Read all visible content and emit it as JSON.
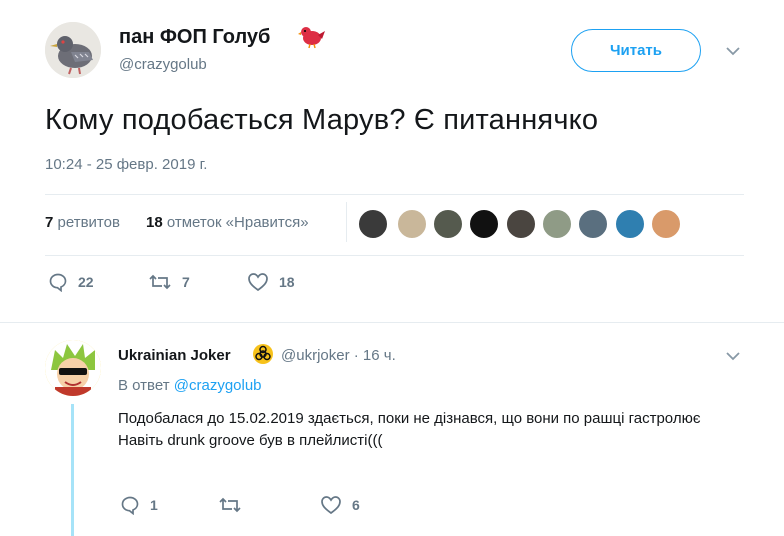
{
  "tweet": {
    "author_name": "пан ФОП Голуб",
    "author_handle": "@crazygolub",
    "follow_label": "Читать",
    "text": "Кому подобається Марув? Є питаннячко",
    "timestamp": "10:24 - 25 февр. 2019 г.",
    "retweets_count": "7",
    "retweets_label": "ретвитов",
    "likes_count": "18",
    "likes_label": "отметок «Нравится»",
    "actions": {
      "reply_count": "22",
      "retweet_count": "7",
      "like_count": "18"
    }
  },
  "reply": {
    "author_name": "Ukrainian Joker",
    "author_handle": "@ukrjoker",
    "time": "· 16 ч.",
    "reply_to_prefix": "В ответ",
    "reply_to_handle": "@crazygolub",
    "text_line1": "Подобалася до 15.02.2019 здається, поки не дізнався, що вони по рашці гастролює",
    "text_line2": "Навіть drunk groove був в плейлисті(((",
    "actions": {
      "reply_count": "1",
      "retweet_count": "",
      "like_count": "6"
    }
  },
  "colors": {
    "accent": "#1da1f2",
    "muted": "#657786",
    "divider": "#e6ecf0"
  }
}
